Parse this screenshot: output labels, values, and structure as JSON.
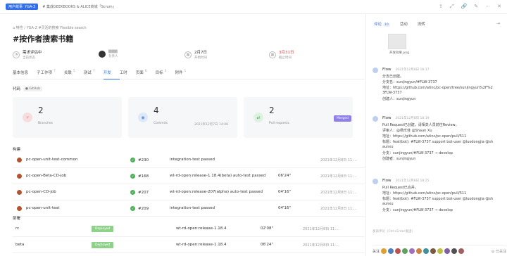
{
  "top": {
    "story_tag": "用户故事",
    "story_id": "YGA-3",
    "crumb": "# 集成GEEKBOOKS & ALICE商城「Scrum」"
  },
  "main": {
    "breadcrumb": "特性 / YGA-2 #灵活的搜索 Flexible search",
    "title": "#按作者搜索书籍",
    "meta": [
      {
        "value": "需求评估中",
        "label": "当前状态"
      },
      {
        "value": "负责人",
        "label": ""
      },
      {
        "value": "2月7日",
        "label": "开始时间"
      },
      {
        "value": "3月31日",
        "label": "截止时间"
      }
    ],
    "tabs": [
      {
        "label": "基本信息",
        "count": ""
      },
      {
        "label": "子工作项",
        "count": "7"
      },
      {
        "label": "关联",
        "count": "5"
      },
      {
        "label": "测试",
        "count": "7"
      },
      {
        "label": "开发",
        "count": ""
      },
      {
        "label": "工时",
        "count": ""
      },
      {
        "label": "页面",
        "count": "6"
      },
      {
        "label": "目标",
        "count": "3"
      },
      {
        "label": "附件",
        "count": "1"
      }
    ],
    "code_label": "代码",
    "github": "GitHub",
    "cards": [
      {
        "num": "2",
        "label": "Branches"
      },
      {
        "num": "4",
        "label": "Commits",
        "time": "2021年12月7日 14:08"
      },
      {
        "num": "2",
        "label": "Pull requests",
        "badge": "Merged"
      }
    ],
    "build_label": "构建",
    "builds": [
      {
        "name": "pc-open-unit-test-common",
        "id": "#230",
        "msg": "integration-test passed",
        "dur": "",
        "time": "2021年12月8日 11:..."
      },
      {
        "name": "pc-open-Beta-CD-job",
        "id": "#168",
        "msg": "wt-rd-open:release-1.18.4(beta) auto-test passed",
        "dur": "06'24\"",
        "time": "2021年12月8日 11:..."
      },
      {
        "name": "pc-open-CD-job",
        "id": "#207",
        "msg": "wt-rd-open:release-207(alpha) auto-test passed",
        "dur": "04'16\"",
        "time": "2021年12月8日 11:..."
      },
      {
        "name": "pc-open-unit-test",
        "id": "#209",
        "msg": "integration-test passed",
        "dur": "04'16\"",
        "time": "2021年12月8日 11:..."
      }
    ],
    "deploy_label": "部署",
    "deploys": [
      {
        "env": "rc",
        "status": "Deployed",
        "branch": "wt-rd-open:release-1.18.4",
        "dur": "02'08\"",
        "time": "2021年12月8日 11:..."
      },
      {
        "env": "beta",
        "status": "Deployed",
        "branch": "wt-rd-open:release-1.18.4",
        "dur": "06'24\"",
        "time": "2021年12月8日 11:..."
      }
    ]
  },
  "side": {
    "tabs": [
      {
        "label": "评论",
        "count": "10"
      },
      {
        "label": "活动",
        "count": ""
      },
      {
        "label": "流转",
        "count": ""
      }
    ],
    "file": "开发效果.png",
    "comments": [
      {
        "who": "Flow",
        "time": "2021年12月8日 18:17",
        "lines": [
          "分支已创建。",
          "分支名：sunjingyun/#FLW-3737",
          "地址：https://github.com/atinc/pc-open/tree/sunjingyun%2F%2",
          "3FLW-3737",
          "创建人：sunjingyun"
        ]
      },
      {
        "who": "Flow",
        "time": "2021年12月8日 18:19",
        "lines": [
          "Pull Request已创建，请相关人员前往Review。",
          "评审人：@杨乐佳  @Shaun Xu",
          "地址：https://github.com/atinc/pc-open/pull/511",
          "标题：feat(bot): #FLW-3737 support bot-user @luodongjia @sh",
          "aunxu",
          "分支：sunjingyun/#FLW-3737 → develop",
          "创建者：sunjingyun"
        ]
      },
      {
        "who": "Flow",
        "time": "2021年12月8日 18:25",
        "lines": [
          "Pull Request已合并。",
          "地址：https://github.com/atinc/pc-open/pull/511",
          "标题：feat(bot): #FLW-3737 support bot-user @luodongjia @sh",
          "aunxu",
          "分支：sunjingyun/#FLW-3737 → develop"
        ]
      }
    ],
    "input_placeholder": "发表评论（Ctrl+Enter发送）",
    "follow_label": "关注",
    "follow_state": "已关注"
  }
}
